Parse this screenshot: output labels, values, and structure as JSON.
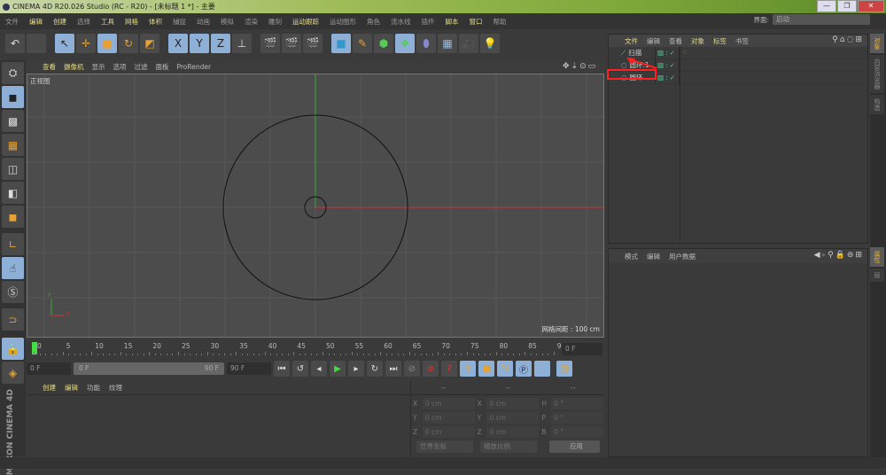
{
  "window": {
    "title": "CINEMA 4D R20.026 Studio (RC - R20) - [未标题 1 *] - 主要",
    "controls": [
      "—",
      "❐",
      "✕"
    ]
  },
  "menu": [
    {
      "label": "文件",
      "hi": false
    },
    {
      "label": "编辑",
      "hi": true
    },
    {
      "label": "创建",
      "hi": true
    },
    {
      "label": "选择",
      "hi": false
    },
    {
      "label": "工具",
      "hi": true
    },
    {
      "label": "网格",
      "hi": true
    },
    {
      "label": "体积",
      "hi": true
    },
    {
      "label": "捕捉",
      "hi": false
    },
    {
      "label": "动画",
      "hi": false
    },
    {
      "label": "模拟",
      "hi": false
    },
    {
      "label": "渲染",
      "hi": false
    },
    {
      "label": "雕刻",
      "hi": false
    },
    {
      "label": "运动跟踪",
      "hi": true
    },
    {
      "label": "运动图形",
      "hi": false
    },
    {
      "label": "角色",
      "hi": false
    },
    {
      "label": "流水线",
      "hi": false
    },
    {
      "label": "插件",
      "hi": false
    },
    {
      "label": "脚本",
      "hi": true
    },
    {
      "label": "窗口",
      "hi": true
    },
    {
      "label": "帮助",
      "hi": false
    }
  ],
  "layout": {
    "label": "界面:",
    "value": "启动"
  },
  "toolbar": {
    "undo": "↶",
    "x": "X",
    "y": "Y",
    "z": "Z"
  },
  "viewport": {
    "menu": [
      {
        "label": "查看",
        "hi": true
      },
      {
        "label": "摄像机",
        "hi": true
      },
      {
        "label": "显示",
        "hi": false
      },
      {
        "label": "选项",
        "hi": false
      },
      {
        "label": "过滤",
        "hi": false
      },
      {
        "label": "面板",
        "hi": false
      },
      {
        "label": "ProRender",
        "hi": false
      }
    ],
    "view_name": "正视图",
    "grid_spacing": "网格间距 : 100 cm",
    "axis_y": "Y",
    "axis_x": "X"
  },
  "timeline": {
    "ticks": [
      "0",
      "5",
      "10",
      "15",
      "20",
      "25",
      "30",
      "35",
      "40",
      "45",
      "50",
      "55",
      "60",
      "65",
      "70",
      "75",
      "80",
      "85",
      "90"
    ],
    "current_frame": "0 F",
    "start": "0 F",
    "range_start": "0 F",
    "range_end": "90 F",
    "end": "90 F"
  },
  "material": {
    "menu": [
      {
        "label": "创建",
        "hi": true
      },
      {
        "label": "编辑",
        "hi": true
      },
      {
        "label": "功能",
        "hi": false
      },
      {
        "label": "纹理",
        "hi": false
      }
    ]
  },
  "coords": {
    "headers": [
      "--",
      "--",
      "--"
    ],
    "rows": [
      [
        "X",
        "0 cm",
        "X",
        "0 cm",
        "H",
        "0 °"
      ],
      [
        "Y",
        "0 cm",
        "Y",
        "0 cm",
        "P",
        "0 °"
      ],
      [
        "Z",
        "0 cm",
        "Z",
        "0 cm",
        "B",
        "0 °"
      ]
    ],
    "mode1": "世界坐标",
    "mode2": "缩放比例",
    "apply": "应用"
  },
  "objects": {
    "menu": [
      {
        "label": "文件",
        "hi": true
      },
      {
        "label": "编辑",
        "hi": false
      },
      {
        "label": "查看",
        "hi": false
      },
      {
        "label": "对象",
        "hi": true
      },
      {
        "label": "标签",
        "hi": true
      },
      {
        "label": "书签",
        "hi": false
      }
    ],
    "items": [
      {
        "name": "扫描",
        "icon": "sweep"
      },
      {
        "name": "圆环.1",
        "icon": "circle"
      },
      {
        "name": "圆环",
        "icon": "circle"
      }
    ]
  },
  "attributes": {
    "menu": [
      "模式",
      "编辑",
      "用户数据"
    ]
  },
  "side_tabs": [
    "对象",
    "内容浏览器",
    "构造"
  ],
  "side_tabs2": [
    "属性",
    "层"
  ],
  "brand": "MAXON CINEMA 4D",
  "colors": {
    "accent": "#e4dc8a",
    "x_axis": "#cc3333",
    "y_axis": "#33aa33",
    "highlight": "#ff2020"
  }
}
